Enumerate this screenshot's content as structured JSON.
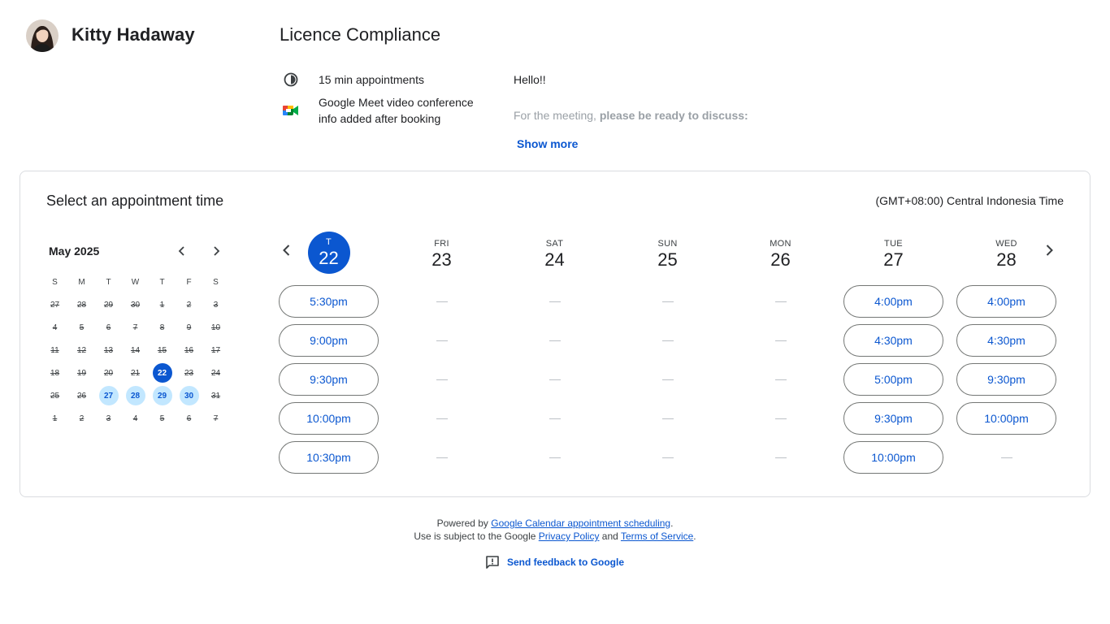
{
  "host": {
    "name": "Kitty Hadaway"
  },
  "title": "Licence Compliance",
  "details": {
    "duration": "15 min appointments",
    "conference": "Google Meet video conference info added after booking"
  },
  "description": {
    "greeting": "Hello!!",
    "lead": "For the meeting, ",
    "emphasis": "please be ready to discuss:",
    "show_more": "Show more"
  },
  "panel": {
    "title": "Select an appointment time",
    "timezone": "(GMT+08:00) Central Indonesia Time"
  },
  "mini_calendar": {
    "month_label": "May 2025",
    "weekday_headers": [
      "S",
      "M",
      "T",
      "W",
      "T",
      "F",
      "S"
    ],
    "days": [
      {
        "label": "27",
        "state": "past"
      },
      {
        "label": "28",
        "state": "past"
      },
      {
        "label": "29",
        "state": "past"
      },
      {
        "label": "30",
        "state": "past"
      },
      {
        "label": "1",
        "state": "past"
      },
      {
        "label": "2",
        "state": "past"
      },
      {
        "label": "3",
        "state": "past"
      },
      {
        "label": "4",
        "state": "past"
      },
      {
        "label": "5",
        "state": "past"
      },
      {
        "label": "6",
        "state": "past"
      },
      {
        "label": "7",
        "state": "past"
      },
      {
        "label": "8",
        "state": "past"
      },
      {
        "label": "9",
        "state": "past"
      },
      {
        "label": "10",
        "state": "past"
      },
      {
        "label": "11",
        "state": "past"
      },
      {
        "label": "12",
        "state": "past"
      },
      {
        "label": "13",
        "state": "past"
      },
      {
        "label": "14",
        "state": "past"
      },
      {
        "label": "15",
        "state": "past"
      },
      {
        "label": "16",
        "state": "past"
      },
      {
        "label": "17",
        "state": "past"
      },
      {
        "label": "18",
        "state": "past"
      },
      {
        "label": "19",
        "state": "past"
      },
      {
        "label": "20",
        "state": "past"
      },
      {
        "label": "21",
        "state": "past"
      },
      {
        "label": "22",
        "state": "selected"
      },
      {
        "label": "23",
        "state": "past"
      },
      {
        "label": "24",
        "state": "past"
      },
      {
        "label": "25",
        "state": "past"
      },
      {
        "label": "26",
        "state": "past"
      },
      {
        "label": "27",
        "state": "available"
      },
      {
        "label": "28",
        "state": "available"
      },
      {
        "label": "29",
        "state": "available"
      },
      {
        "label": "30",
        "state": "available"
      },
      {
        "label": "31",
        "state": "past"
      },
      {
        "label": "1",
        "state": "past"
      },
      {
        "label": "2",
        "state": "past"
      },
      {
        "label": "3",
        "state": "past"
      },
      {
        "label": "4",
        "state": "past"
      },
      {
        "label": "5",
        "state": "past"
      },
      {
        "label": "6",
        "state": "past"
      },
      {
        "label": "7",
        "state": "past"
      }
    ]
  },
  "week": [
    {
      "dow": "T",
      "date": "22",
      "selected": true,
      "slots": [
        "5:30pm",
        "9:00pm",
        "9:30pm",
        "10:00pm",
        "10:30pm"
      ],
      "empty_rows": 0
    },
    {
      "dow": "FRI",
      "date": "23",
      "selected": false,
      "slots": [],
      "empty_rows": 5
    },
    {
      "dow": "SAT",
      "date": "24",
      "selected": false,
      "slots": [],
      "empty_rows": 5
    },
    {
      "dow": "SUN",
      "date": "25",
      "selected": false,
      "slots": [],
      "empty_rows": 5
    },
    {
      "dow": "MON",
      "date": "26",
      "selected": false,
      "slots": [],
      "empty_rows": 5
    },
    {
      "dow": "TUE",
      "date": "27",
      "selected": false,
      "slots": [
        "4:00pm",
        "4:30pm",
        "5:00pm",
        "9:30pm",
        "10:00pm"
      ],
      "empty_rows": 0
    },
    {
      "dow": "WED",
      "date": "28",
      "selected": false,
      "slots": [
        "4:00pm",
        "4:30pm",
        "9:30pm",
        "10:00pm"
      ],
      "empty_rows": 1
    }
  ],
  "footer": {
    "powered_prefix": "Powered by ",
    "powered_link": "Google Calendar appointment scheduling",
    "powered_suffix": ".",
    "terms_prefix": "Use is subject to the Google ",
    "privacy_link": "Privacy Policy",
    "and": " and ",
    "terms_link": "Terms of Service",
    "terms_suffix": ".",
    "feedback": "Send feedback to Google"
  },
  "colors": {
    "accent": "#0b57d0",
    "available_bg": "#c2e7ff",
    "border": "#dadce0"
  },
  "icons": [
    "avatar",
    "clock-icon",
    "google-meet-icon",
    "chevron-left-icon",
    "chevron-right-icon",
    "feedback-icon"
  ]
}
